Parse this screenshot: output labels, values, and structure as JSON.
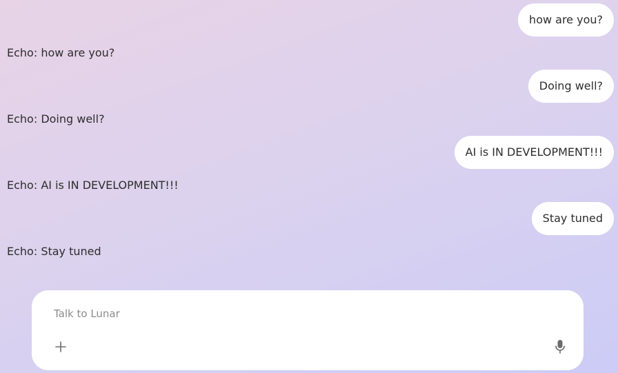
{
  "messages": [
    {
      "user": "how are you?",
      "echo": "Echo: how are you?"
    },
    {
      "user": "Doing well?",
      "echo": "Echo: Doing well?"
    },
    {
      "user": "AI is IN DEVELOPMENT!!!",
      "echo": "Echo: AI is IN DEVELOPMENT!!!"
    },
    {
      "user": "Stay tuned",
      "echo": "Echo: Stay tuned"
    }
  ],
  "composer": {
    "placeholder": "Talk to Lunar",
    "value": ""
  },
  "icons": {
    "add": "plus-icon",
    "voice": "microphone-icon"
  },
  "colors": {
    "bubble": "#ffffff",
    "text": "#2d2d2d",
    "placeholder": "#8b8b8b",
    "icon": "#6b6b6b"
  }
}
